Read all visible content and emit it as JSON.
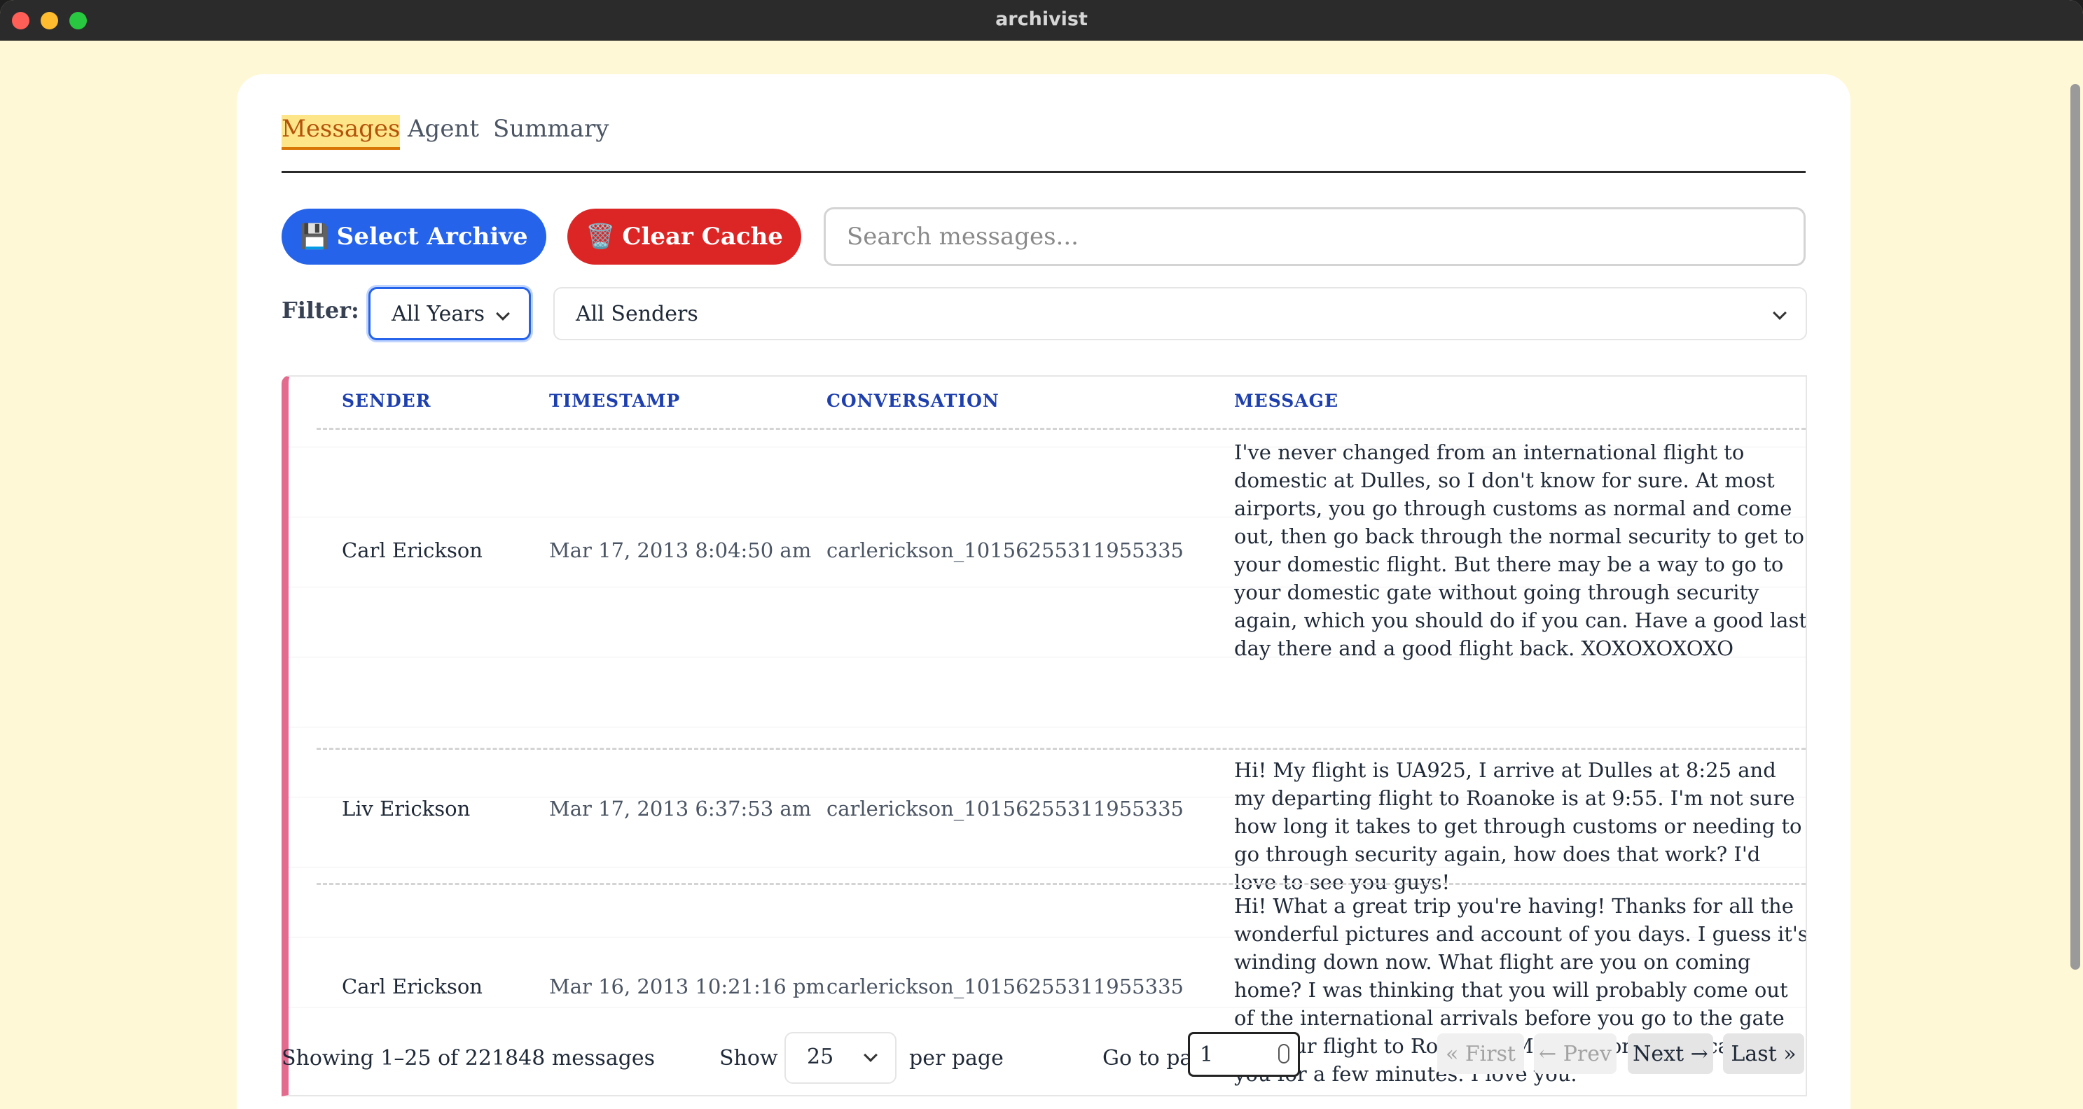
{
  "window": {
    "title": "archivist"
  },
  "tabs": [
    {
      "label": "Messages",
      "active": true
    },
    {
      "label": "Agent",
      "active": false
    },
    {
      "label": "Summary",
      "active": false
    }
  ],
  "toolbar": {
    "select_archive_icon": "💾",
    "select_archive_label": "Select Archive",
    "clear_cache_icon": "🗑️",
    "clear_cache_label": "Clear Cache",
    "search_placeholder": "Search messages..."
  },
  "filter": {
    "label": "Filter:",
    "years_value": "All Years",
    "senders_value": "All Senders"
  },
  "table": {
    "columns": [
      "SENDER",
      "TIMESTAMP",
      "CONVERSATION",
      "MESSAGE"
    ],
    "rows": [
      {
        "sender": "Carl Erickson",
        "timestamp": "Mar 17, 2013 8:04:50 am",
        "conversation": "carlerickson_10156255311955335",
        "message": "I've never changed from an international flight to domestic at Dulles, so I don't know for sure. At most airports, you go through customs as normal and come out, then go back through the normal security to get to your domestic flight. But there may be a way to go to your domestic gate without going through security again, which you should do if you can. Have a good last day there and a good flight back. XOXOXOXOXO"
      },
      {
        "sender": "Liv Erickson",
        "timestamp": "Mar 17, 2013 6:37:53 am",
        "conversation": "carlerickson_10156255311955335",
        "message": "Hi! My flight is UA925, I arrive at Dulles at 8:25 and my departing flight to Roanoke is at 9:55. I'm not sure how long it takes to get through customs or needing to go through security again, how does that work? I'd love to see you guys!"
      },
      {
        "sender": "Carl Erickson",
        "timestamp": "Mar 16, 2013 10:21:16 pm",
        "conversation": "carlerickson_10156255311955335",
        "message": "Hi! What a great trip you're having! Thanks for all the wonderful pictures and account of you days. I guess it's winding down now. What flight are you on coming home? I was thinking that you will probably come out of the international arrivals before you go to the gate for your flight to Roanoke. Maybe Mom and I can see you for a few minutes. I love you."
      }
    ]
  },
  "footer": {
    "showing": "Showing 1–25 of 221848 messages",
    "show_label": "Show",
    "per_page_value": "25",
    "per_page_label": "per page",
    "goto_label": "Go to page",
    "page_value": "1",
    "first": "« First",
    "prev": "← Prev",
    "next": "Next →",
    "last": "Last »"
  },
  "colors": {
    "background": "#fff8d6",
    "primary": "#2563eb",
    "danger": "#dc2626",
    "active_tab": "#b45309",
    "header_text": "#1e40af",
    "row_accent": "#e26b8e"
  }
}
